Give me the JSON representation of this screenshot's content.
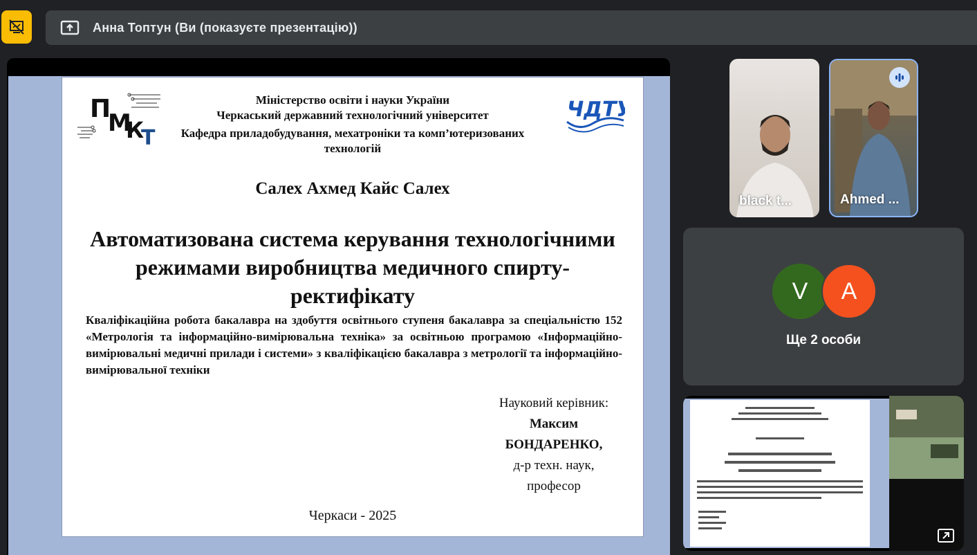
{
  "topbar": {
    "presentation_label": "Анна Топтун (Ви (показуєте презентацію))",
    "accent": "#fbbc04"
  },
  "slide": {
    "header_lines": [
      "Міністерство освіти і науки України",
      "Черкаський державний технологічний університет",
      "Кафедра приладобудування, мехатроніки та комп’ютеризованих технологій"
    ],
    "logo_left_text": "ПМКТ",
    "logo_right_text": "ЧДТУ",
    "author": "Салех Ахмед Кайс Салех",
    "thesis_title": "Автоматизована система керування технологічними режимами виробництва медичного спирту-ректифікату",
    "qualification": "Кваліфікаційна робота бакалавра на здобуття освітнього ступеня бакалавра за спеціальністю 152 «Метрологія та інформаційно-вимірювальна техніка» за освітньою програмою «Інформаційно-вимірювальні медичні прилади і системи» з кваліфікацією бакалавра з метрології та інформаційно-вимірювальної техніки",
    "supervisor": {
      "label": "Науковий керівник:",
      "first_name": "Максим",
      "last_name": "БОНДАРЕНКО,",
      "degree": "д-р техн. наук,",
      "title": "професор"
    },
    "city_year": "Черкаси - 2025"
  },
  "participants": [
    {
      "name": "black t..."
    },
    {
      "name": "Ahmed ..."
    }
  ],
  "others": {
    "avatars": [
      "V",
      "A"
    ],
    "label": "Ще 2 особи"
  },
  "self_view": {
    "name": "Анна Топтун"
  }
}
